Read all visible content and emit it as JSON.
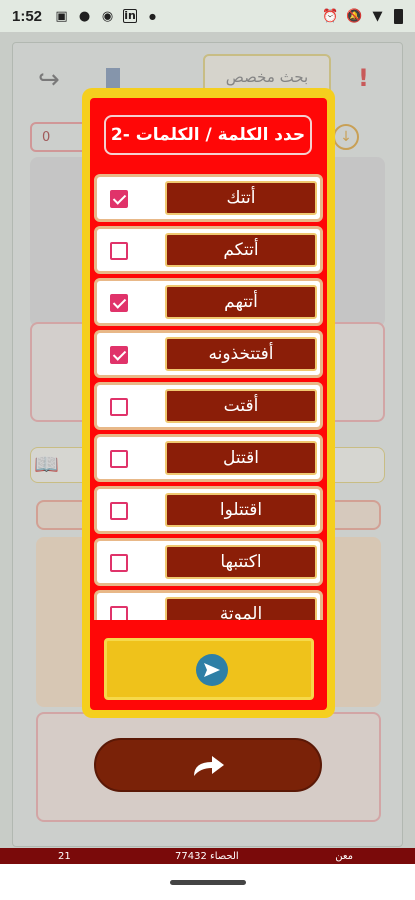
{
  "status_bar": {
    "time": "1:52",
    "left_icons": [
      "twitch-icon",
      "circle-icon",
      "media-icon",
      "linkedin-icon",
      "dot-icon"
    ],
    "right_icons": [
      "alarm-icon",
      "mute-icon",
      "wifi-icon",
      "battery-icon"
    ]
  },
  "background": {
    "search_label": "بحث مخصص",
    "counter": "0"
  },
  "dialog": {
    "title": "2- حدد الكلمة / الكلمات",
    "items": [
      {
        "label": "أتتك",
        "checked": true
      },
      {
        "label": "أتتكم",
        "checked": false
      },
      {
        "label": "أتتهم",
        "checked": true
      },
      {
        "label": "أفتتخذونه",
        "checked": true
      },
      {
        "label": "أقتت",
        "checked": false
      },
      {
        "label": "اقتتل",
        "checked": false
      },
      {
        "label": "اقتتلوا",
        "checked": false
      },
      {
        "label": "اكتتبها",
        "checked": false
      },
      {
        "label": "الموتة",
        "checked": false
      }
    ],
    "send_icon": "send-icon"
  },
  "big_button": {
    "icon": "redo-arrow-icon"
  },
  "bottom_strip": {
    "left": "21",
    "mid": "77432 الحصاء",
    "right": "معن"
  },
  "colors": {
    "dialog_border": "#f5cf1e",
    "dialog_bg": "#ff0707",
    "word_bg": "#8b1e08",
    "checkbox": "#e0336a",
    "button": "#7a2208"
  }
}
